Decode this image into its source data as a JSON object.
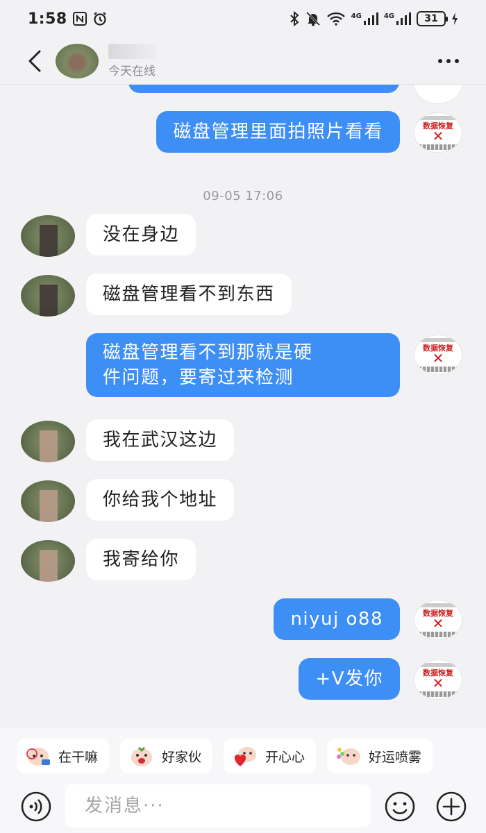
{
  "status_bar": {
    "time": "1:58",
    "battery": "31",
    "network_1": "4G",
    "network_2": "4G"
  },
  "header": {
    "contact_name": "",
    "online_status": "今天在线"
  },
  "timestamp": "09-05 17:06",
  "messages": [
    {
      "side": "out",
      "text": "磁盘管理里面拍照片看看"
    },
    {
      "side": "in",
      "text": "没在身边"
    },
    {
      "side": "in",
      "text": "磁盘管理看不到东西"
    },
    {
      "side": "out",
      "text_line1": "磁盘管理看不到那就是硬",
      "text_line2": "件问题，要寄过来检测"
    },
    {
      "side": "in",
      "text": "我在武汉这边"
    },
    {
      "side": "in",
      "text": "你给我个地址"
    },
    {
      "side": "in",
      "text": "我寄给你"
    },
    {
      "side": "out",
      "text": "niyuj  o88"
    },
    {
      "side": "out",
      "text": "+V发你"
    }
  ],
  "self_avatar": {
    "label": "数据恢复",
    "logo_color": "#d01c1c"
  },
  "quick_replies": [
    {
      "label": "在干嘛",
      "icon": "sticker-hello-icon"
    },
    {
      "label": "好家伙",
      "icon": "sticker-wow-icon"
    },
    {
      "label": "开心心",
      "icon": "sticker-heart-icon"
    },
    {
      "label": "好运喷雾",
      "icon": "sticker-luck-icon"
    }
  ],
  "input": {
    "placeholder": "发消息···"
  },
  "colors": {
    "accent": "#3d8ef5",
    "background": "#f2f2f4",
    "bubble_in": "#ffffff"
  }
}
